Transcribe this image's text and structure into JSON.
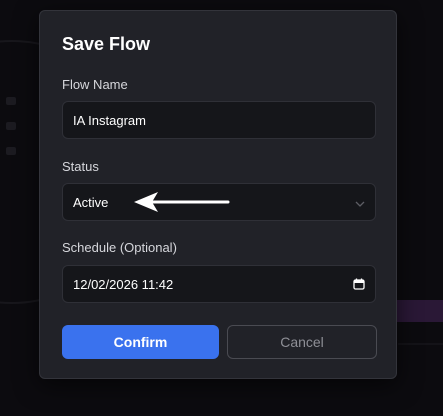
{
  "modal": {
    "title": "Save Flow",
    "flow_name": {
      "label": "Flow Name",
      "value": "IA Instagram"
    },
    "status": {
      "label": "Status",
      "selected": "Active"
    },
    "schedule": {
      "label": "Schedule (Optional)",
      "value": "12/02/2026 11:42"
    },
    "confirm_label": "Confirm",
    "cancel_label": "Cancel"
  },
  "icons": {
    "status_dropdown": "chevron-down-icon",
    "schedule_picker": "calendar-icon",
    "annotation": "arrow-left-icon"
  },
  "colors": {
    "accent": "#3a72ee",
    "modal_bg": "#212228",
    "field_bg": "#15161a",
    "annotation_arrow": "#ffffff"
  }
}
